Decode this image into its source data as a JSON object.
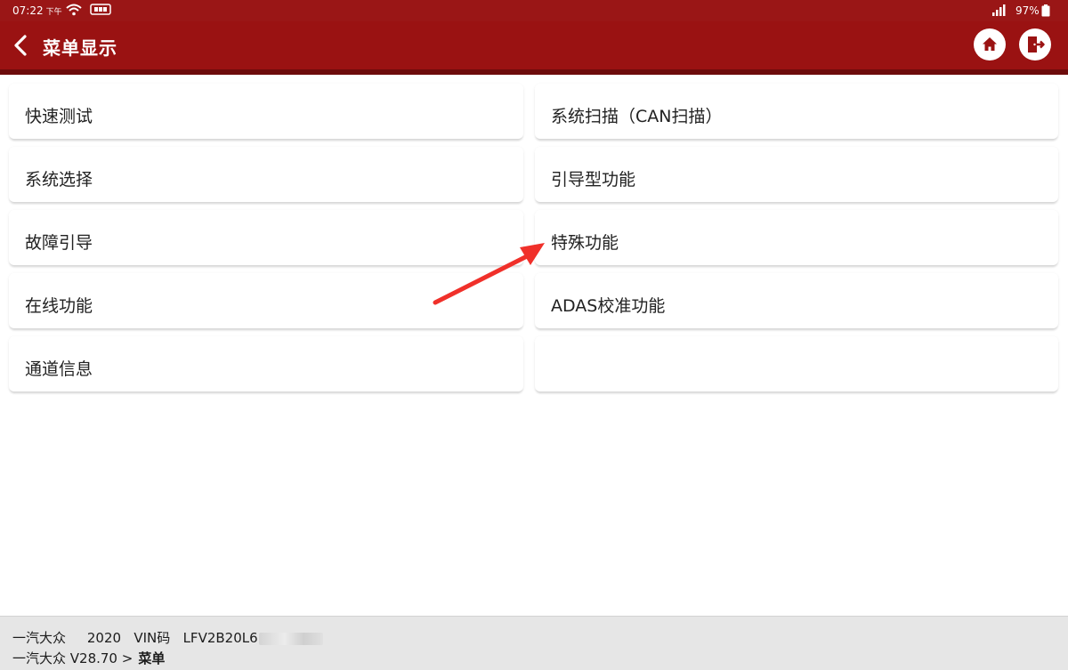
{
  "statusbar": {
    "time": "07:22",
    "ampm": "下午",
    "battery": "97%"
  },
  "header": {
    "title": "菜单显示"
  },
  "menu": {
    "items": [
      {
        "label": "快速测试"
      },
      {
        "label": "系统扫描（CAN扫描）"
      },
      {
        "label": "系统选择"
      },
      {
        "label": "引导型功能"
      },
      {
        "label": "故障引导"
      },
      {
        "label": "特殊功能"
      },
      {
        "label": "在线功能"
      },
      {
        "label": "ADAS校准功能"
      },
      {
        "label": "通道信息"
      },
      {
        "label": ""
      }
    ]
  },
  "footer": {
    "brand": "一汽大众",
    "year": "2020",
    "vin_label": "VIN码",
    "vin_value": "LFV2B20L6",
    "path": "一汽大众 V28.70 >",
    "current": "菜单"
  },
  "colors": {
    "header_red": "#9a1212",
    "header_shadow": "#6d0c0c",
    "arrow_red": "#f0302a"
  }
}
